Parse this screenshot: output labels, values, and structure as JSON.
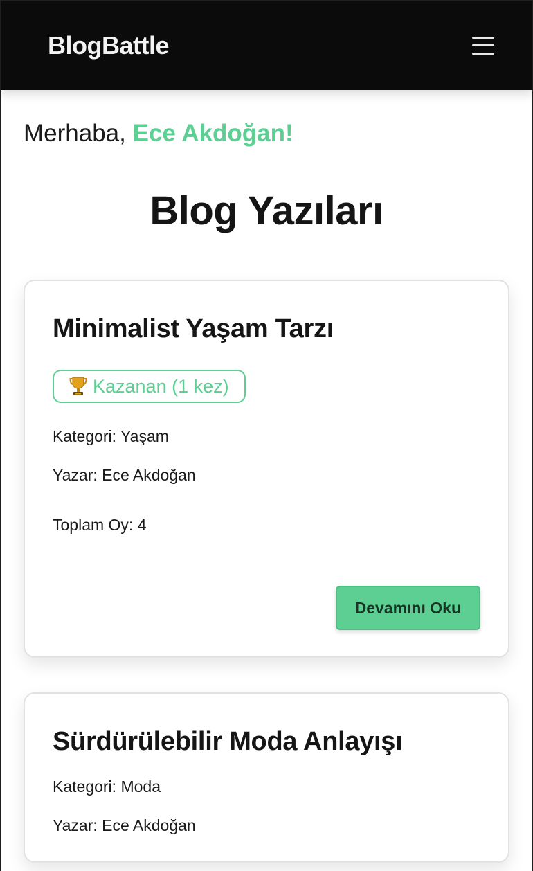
{
  "navbar": {
    "brand": "BlogBattle",
    "menu_icon": "hamburger-menu-icon"
  },
  "greeting": {
    "prefix": "Merhaba, ",
    "name": "Ece Akdoğan!"
  },
  "page": {
    "title": "Blog Yazıları"
  },
  "colors": {
    "accent": "#5dcf93",
    "navbar_bg": "#0b0b0b"
  },
  "posts": [
    {
      "title": "Minimalist Yaşam Tarzı",
      "badge": "Kazanan (1 kez)",
      "badge_icon": "trophy-icon",
      "category": "Kategori: Yaşam",
      "author": "Yazar: Ece Akdoğan",
      "votes": "Toplam Oy: 4",
      "read_more": "Devamını Oku"
    },
    {
      "title": "Sürdürülebilir Moda Anlayışı",
      "category": "Kategori: Moda",
      "author": "Yazar: Ece Akdoğan"
    }
  ]
}
